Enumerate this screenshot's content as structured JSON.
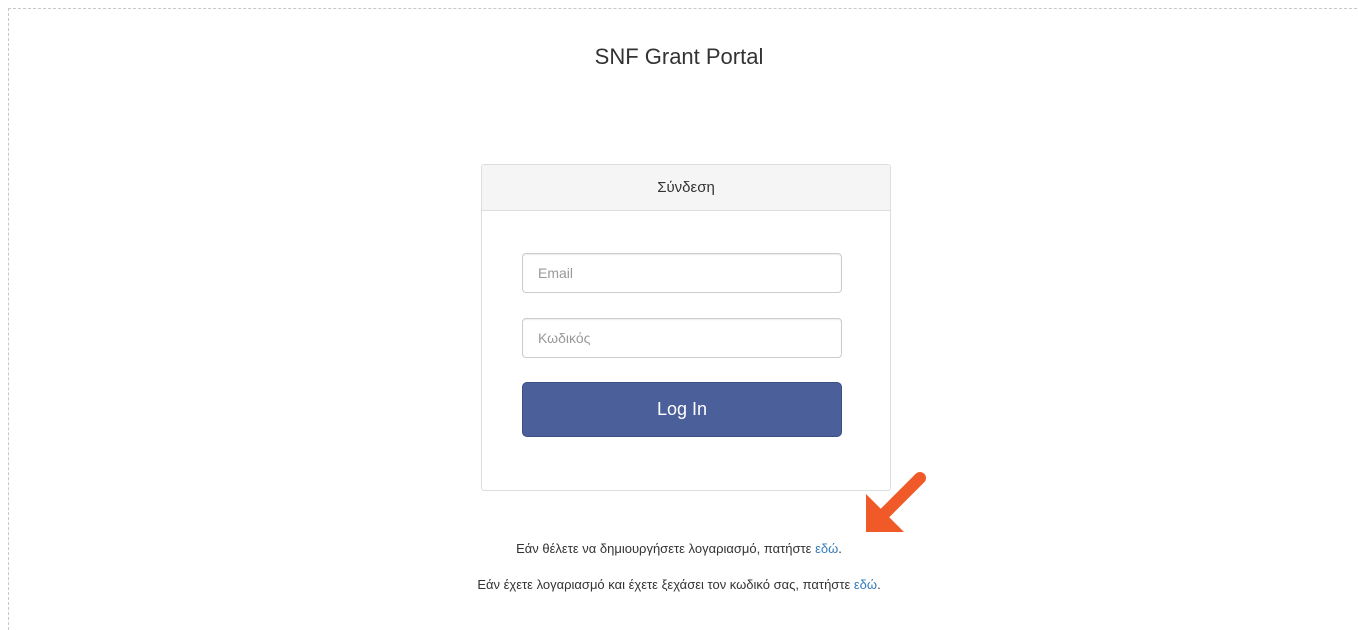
{
  "header": {
    "title": "SNF Grant Portal"
  },
  "login_panel": {
    "heading": "Σύνδεση",
    "email_placeholder": "Email",
    "password_placeholder": "Κωδικός",
    "login_label": "Log In"
  },
  "footer_links": {
    "signup_text": "Εάν θέλετε να δημιουργήσετε λογαριασμό, πατήστε ",
    "signup_link": "εδώ",
    "signup_end": ".",
    "forgot_text": "Εάν έχετε λογαριασμό και έχετε ξεχάσει τον κωδικό σας, πατήστε ",
    "forgot_link": "εδώ",
    "forgot_end": "."
  },
  "colors": {
    "login_button": "#4b5f9b",
    "link": "#337ab7",
    "annotation_arrow": "#f05a28"
  },
  "annotation": {
    "icon": "arrow-down-left-icon"
  }
}
